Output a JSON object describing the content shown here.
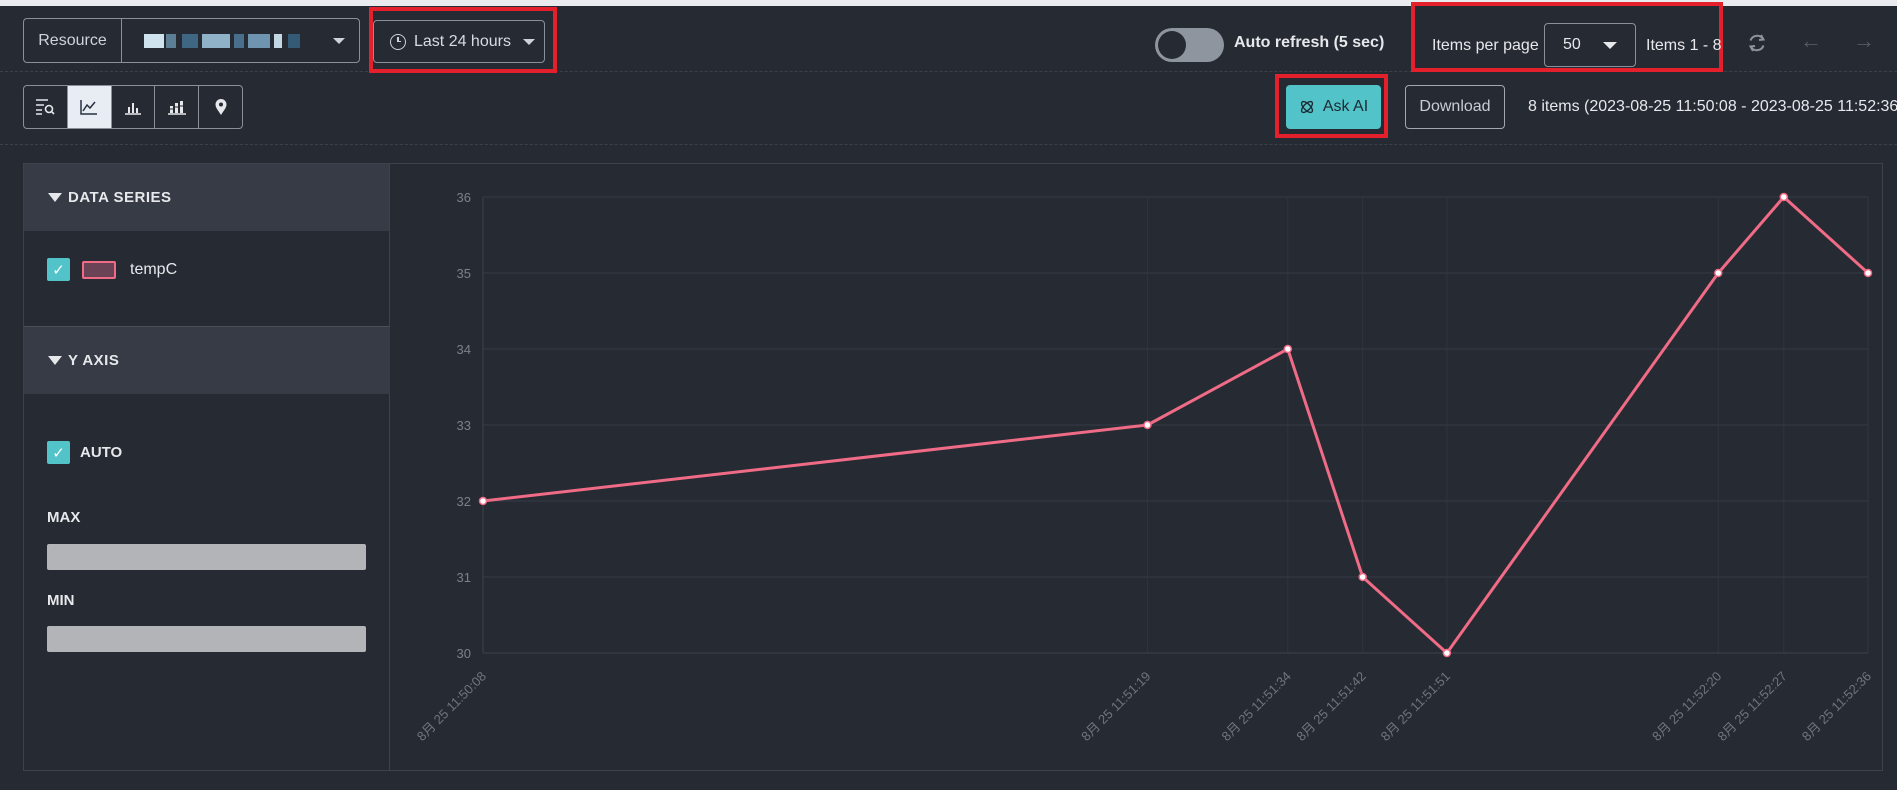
{
  "toolbar": {
    "resource_label": "Resource",
    "time_range": "Last 24 hours",
    "auto_refresh_label": "Auto refresh (5 sec)",
    "items_per_page_label": "Items per page",
    "items_per_page_value": "50",
    "items_range": "Items 1 - 8"
  },
  "actions": {
    "ask_ai": "Ask AI",
    "download": "Download",
    "summary": "8 items (2023-08-25 11:50:08 - 2023-08-25 11:52:36)"
  },
  "sidebar": {
    "data_series_title": "DATA SERIES",
    "series_name": "tempC",
    "y_axis_title": "Y AXIS",
    "auto_label": "AUTO",
    "max_label": "MAX",
    "min_label": "MIN"
  },
  "colors": {
    "series": "#ef6b86",
    "accent": "#52c3c9",
    "highlight": "#e3202b"
  },
  "chart_data": {
    "type": "line",
    "x": [
      "8月 25 11:50:08",
      "8月 25 11:51:19",
      "8月 25 11:51:34",
      "8月 25 11:51:42",
      "8月 25 11:51:51",
      "8月 25 11:52:20",
      "8月 25 11:52:27",
      "8月 25 11:52:36"
    ],
    "x_seconds": [
      0,
      71,
      86,
      94,
      103,
      132,
      139,
      148
    ],
    "series": [
      {
        "name": "tempC",
        "values": [
          32,
          33,
          34,
          31,
          30,
          35,
          36,
          35
        ]
      }
    ],
    "ylim": [
      30,
      36
    ],
    "yticks": [
      "30",
      "31",
      "32",
      "33",
      "34",
      "35",
      "36"
    ],
    "grid": true
  }
}
